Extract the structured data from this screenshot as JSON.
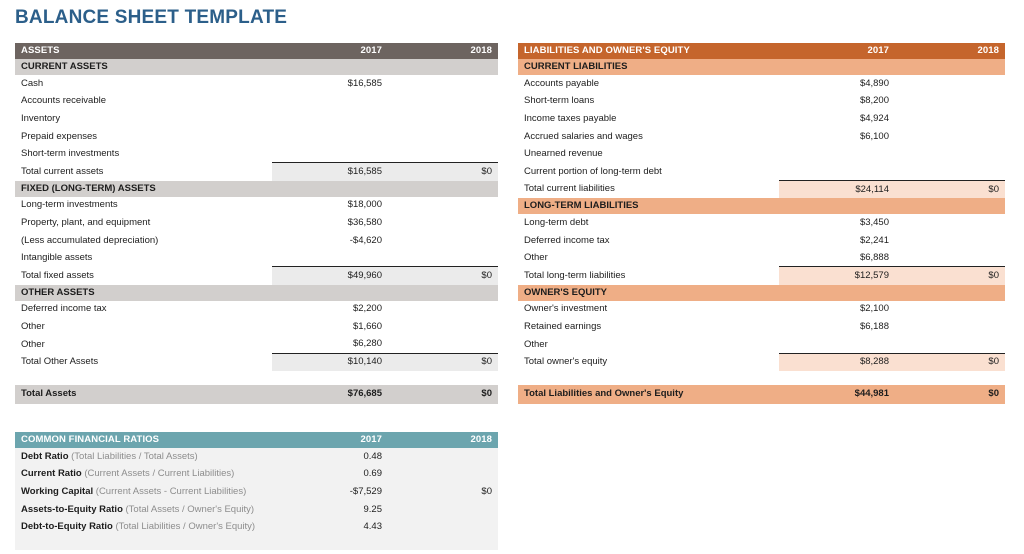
{
  "title": "BALANCE SHEET TEMPLATE",
  "colors": {
    "title": "#2c5f8a",
    "assets_header": "#6d6460",
    "assets_section": "#d2cfcd",
    "assets_subtotal": "#ebebeb",
    "liabilities_header": "#c5652c",
    "liabilities_section": "#efae86",
    "liabilities_subtotal": "#fae0d1",
    "ratios_header": "#6ca5ae",
    "ratios_body": "#f2f2f2"
  },
  "assets": {
    "header": {
      "label": "ASSETS",
      "year1": "2017",
      "year2": "2018"
    },
    "sections": [
      {
        "title": "CURRENT ASSETS",
        "rows": [
          {
            "label": "Cash",
            "y1": "$16,585",
            "y2": ""
          },
          {
            "label": "Accounts receivable",
            "y1": "",
            "y2": ""
          },
          {
            "label": "Inventory",
            "y1": "",
            "y2": ""
          },
          {
            "label": "Prepaid expenses",
            "y1": "",
            "y2": ""
          },
          {
            "label": "Short-term investments",
            "y1": "",
            "y2": ""
          }
        ],
        "total": {
          "label": "Total current assets",
          "y1": "$16,585",
          "y2": "$0"
        }
      },
      {
        "title": "FIXED (LONG-TERM) ASSETS",
        "rows": [
          {
            "label": "Long-term investments",
            "y1": "$18,000",
            "y2": ""
          },
          {
            "label": "Property, plant, and equipment",
            "y1": "$36,580",
            "y2": ""
          },
          {
            "label": "(Less accumulated depreciation)",
            "y1": "-$4,620",
            "y2": ""
          },
          {
            "label": "Intangible assets",
            "y1": "",
            "y2": ""
          }
        ],
        "total": {
          "label": "Total fixed assets",
          "y1": "$49,960",
          "y2": "$0"
        }
      },
      {
        "title": "OTHER ASSETS",
        "rows": [
          {
            "label": "Deferred income tax",
            "y1": "$2,200",
            "y2": ""
          },
          {
            "label": "Other",
            "y1": "$1,660",
            "y2": ""
          },
          {
            "label": "Other",
            "y1": "$6,280",
            "y2": ""
          }
        ],
        "total": {
          "label": "Total Other Assets",
          "y1": "$10,140",
          "y2": "$0"
        }
      }
    ],
    "grand_total": {
      "label": "Total Assets",
      "y1": "$76,685",
      "y2": "$0"
    }
  },
  "liabilities": {
    "header": {
      "label": "LIABILITIES AND OWNER'S EQUITY",
      "year1": "2017",
      "year2": "2018"
    },
    "sections": [
      {
        "title": "CURRENT LIABILITIES",
        "rows": [
          {
            "label": "Accounts payable",
            "y1": "$4,890",
            "y2": ""
          },
          {
            "label": "Short-term loans",
            "y1": "$8,200",
            "y2": ""
          },
          {
            "label": "Income taxes payable",
            "y1": "$4,924",
            "y2": ""
          },
          {
            "label": "Accrued salaries and wages",
            "y1": "$6,100",
            "y2": ""
          },
          {
            "label": "Unearned revenue",
            "y1": "",
            "y2": ""
          },
          {
            "label": "Current portion of long-term debt",
            "y1": "",
            "y2": ""
          }
        ],
        "total": {
          "label": "Total current liabilities",
          "y1": "$24,114",
          "y2": "$0"
        }
      },
      {
        "title": "LONG-TERM LIABILITIES",
        "rows": [
          {
            "label": "Long-term debt",
            "y1": "$3,450",
            "y2": ""
          },
          {
            "label": "Deferred income tax",
            "y1": "$2,241",
            "y2": ""
          },
          {
            "label": "Other",
            "y1": "$6,888",
            "y2": ""
          }
        ],
        "total": {
          "label": "Total long-term liabilities",
          "y1": "$12,579",
          "y2": "$0"
        }
      },
      {
        "title": "OWNER'S EQUITY",
        "rows": [
          {
            "label": "Owner's investment",
            "y1": "$2,100",
            "y2": ""
          },
          {
            "label": "Retained earnings",
            "y1": "$6,188",
            "y2": ""
          },
          {
            "label": "Other",
            "y1": "",
            "y2": ""
          }
        ],
        "total": {
          "label": "Total owner's equity",
          "y1": "$8,288",
          "y2": "$0"
        }
      }
    ],
    "grand_total": {
      "label": "Total Liabilities and Owner's Equity",
      "y1": "$44,981",
      "y2": "$0"
    }
  },
  "ratios": {
    "header": {
      "label": "COMMON FINANCIAL RATIOS",
      "year1": "2017",
      "year2": "2018"
    },
    "rows": [
      {
        "name": "Debt Ratio",
        "desc": "(Total Liabilities / Total Assets)",
        "y1": "0.48",
        "y2": ""
      },
      {
        "name": "Current Ratio",
        "desc": "(Current Assets / Current Liabilities)",
        "y1": "0.69",
        "y2": ""
      },
      {
        "name": "Working Capital",
        "desc": "(Current Assets - Current Liabilities)",
        "y1": "-$7,529",
        "y2": "$0"
      },
      {
        "name": "Assets-to-Equity Ratio",
        "desc": "(Total Assets / Owner's Equity)",
        "y1": "9.25",
        "y2": ""
      },
      {
        "name": "Debt-to-Equity Ratio",
        "desc": "(Total Liabilities / Owner's Equity)",
        "y1": "4.43",
        "y2": ""
      }
    ]
  }
}
